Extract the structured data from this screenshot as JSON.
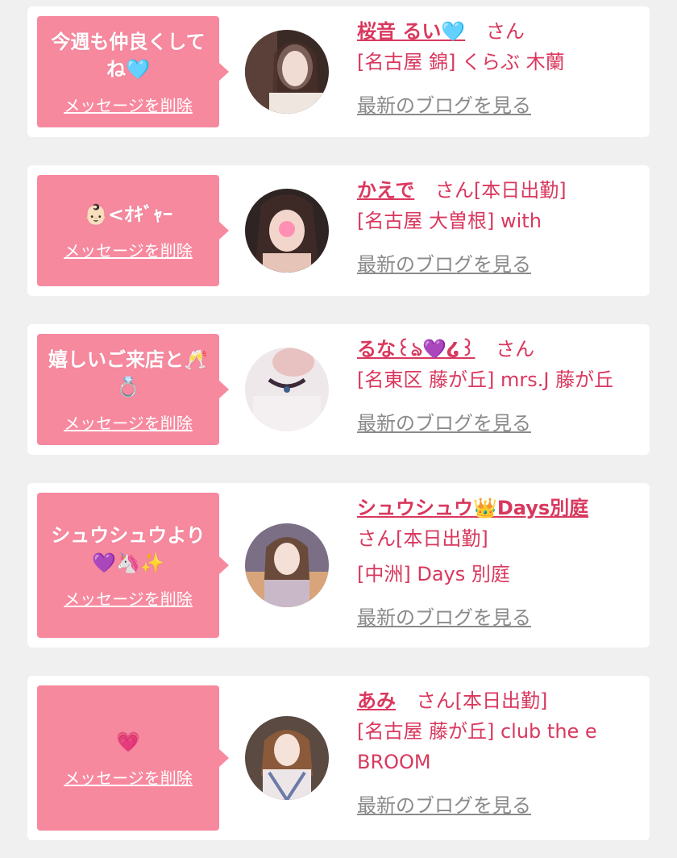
{
  "colors": {
    "bubble": "#f7899f",
    "accent": "#d9385e",
    "link_gray": "#8a8a8a",
    "background": "#f0f0f0"
  },
  "delete_label": "メッセージを削除",
  "blog_label": "最新のブログを見る",
  "san_label": "さん",
  "cards": [
    {
      "message": "今週も仲良くしてね🩵",
      "name": "桜音 るい🩵",
      "suffix": "さん",
      "shop": "[名古屋 錦] くらぶ 木蘭"
    },
    {
      "message": "👶🏻<ｵｷﾞｬｰ",
      "name": "かえで",
      "suffix": "さん[本日出勤]",
      "shop": "[名古屋 大曽根] with"
    },
    {
      "message": "嬉しいご来店と🥂💍",
      "name": "るな꒰ঌ💜໒꒱",
      "suffix": "さん",
      "shop": "[名東区 藤が丘] mrs.J 藤が丘"
    },
    {
      "message": "シュウシュウより💜🦄✨",
      "name": "シュウシュウ👑Days別庭",
      "suffix": "さん[本日出勤]",
      "shop": "[中洲] Days 別庭"
    },
    {
      "message": "💗",
      "name": "あみ",
      "suffix": "さん[本日出勤]",
      "shop": "[名古屋 藤が丘] club the e BROOM"
    }
  ]
}
